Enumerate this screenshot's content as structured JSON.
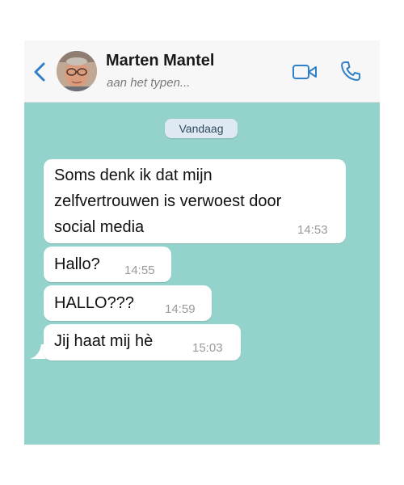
{
  "header": {
    "contact_name": "Marten Mantel",
    "status": "aan het typen...",
    "back_icon": "chevron-left-icon",
    "video_icon": "video-camera-icon",
    "call_icon": "phone-icon",
    "accent_color": "#2f7fc9"
  },
  "chat": {
    "background_color": "#93d3cc",
    "date_label": "Vandaag",
    "messages": [
      {
        "lines": [
          "Soms denk ik dat mijn",
          "zelfvertrouwen is verwoest door",
          "social media"
        ],
        "time": "14:53"
      },
      {
        "lines": [
          "Hallo?"
        ],
        "time": "14:55"
      },
      {
        "lines": [
          "HALLO???"
        ],
        "time": "14:59"
      },
      {
        "lines": [
          "Jij haat mij hè"
        ],
        "time": "15:03"
      }
    ]
  }
}
